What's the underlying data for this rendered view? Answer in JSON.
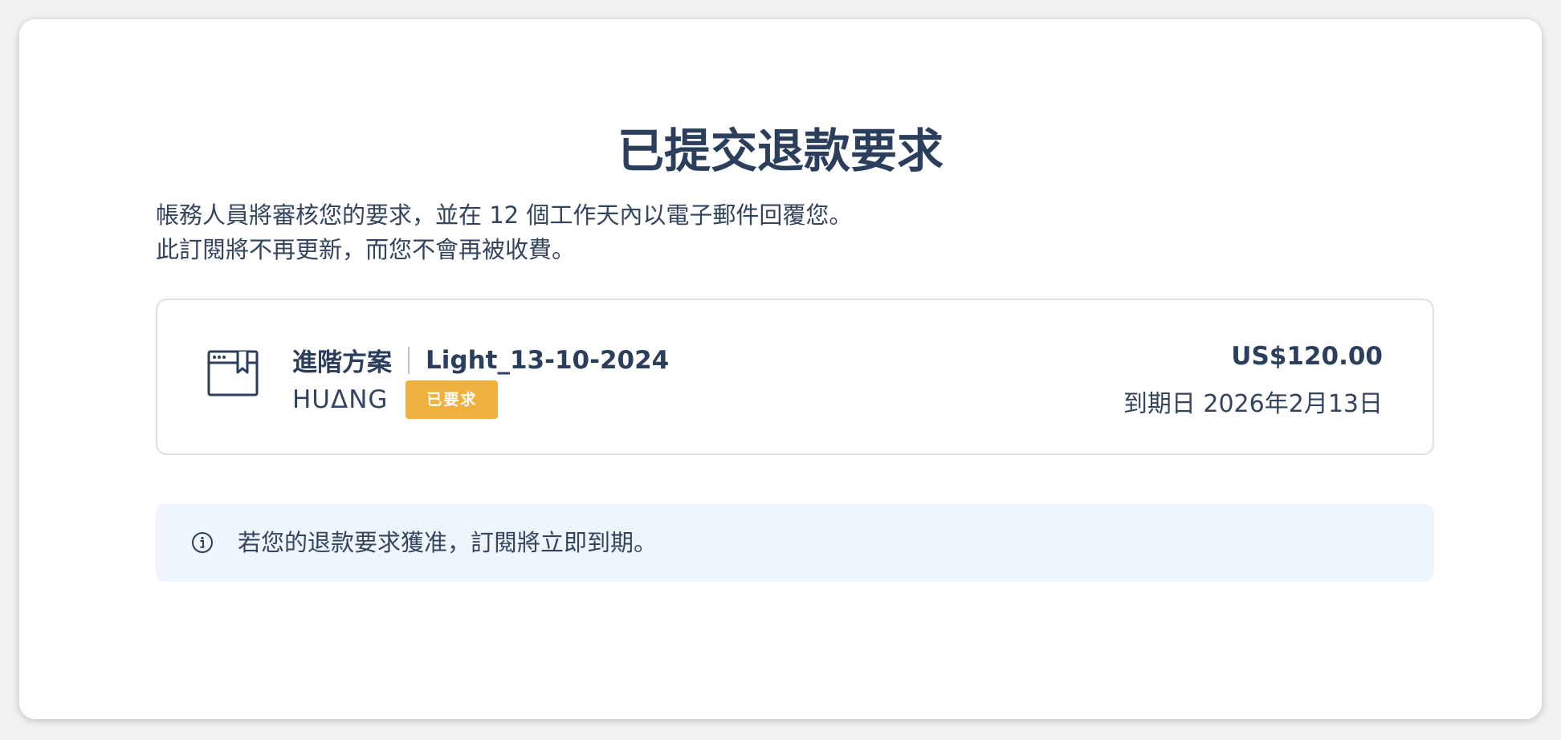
{
  "page": {
    "title": "已提交退款要求",
    "description_line1": "帳務人員將審核您的要求，並在 12 個工作天內以電子郵件回覆您。",
    "description_line2": "此訂閱將不再更新，而您不會再被收費。"
  },
  "subscription": {
    "icon": "browser-bookmark-icon",
    "plan_name": "進階方案",
    "subscription_name": "Light_13-10-2024",
    "owner": "HUΔNG",
    "status_badge": "已要求",
    "status_color": "#f0b03e",
    "price": "US$120.00",
    "expiry": "到期日 2026年2月13日"
  },
  "notice": {
    "icon": "info-icon",
    "text": "若您的退款要求獲准，訂閱將立即到期。"
  }
}
